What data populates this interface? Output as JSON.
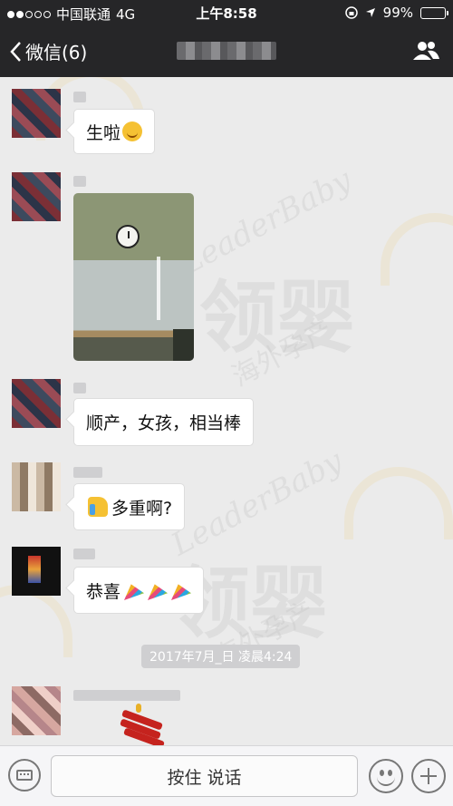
{
  "status_bar": {
    "carrier": "中国联通",
    "network": "4G",
    "time": "上午8:58",
    "battery": "99%",
    "battery_level": 0.99
  },
  "nav": {
    "back_label": "微信(6)"
  },
  "messages": [
    {
      "text": "生啦",
      "emoji": "smiley-icon"
    },
    {
      "type": "image"
    },
    {
      "text": "顺产，女孩，相当棒"
    },
    {
      "text": "多重啊?",
      "emoji": "thumbs-up-icon"
    },
    {
      "text": "恭喜",
      "emoji": "party-popper-icon"
    }
  ],
  "time_separator": "2017年7月_日 凌晨4:24",
  "watermark": {
    "en": "LeaderBaby",
    "cn": "领婴",
    "sub": "海外孕产"
  },
  "input_bar": {
    "hold_to_talk": "按住 说话"
  },
  "colors": {
    "nav_bg": "#262628",
    "chat_bg": "#ebebeb",
    "bubble_bg": "#ffffff"
  }
}
